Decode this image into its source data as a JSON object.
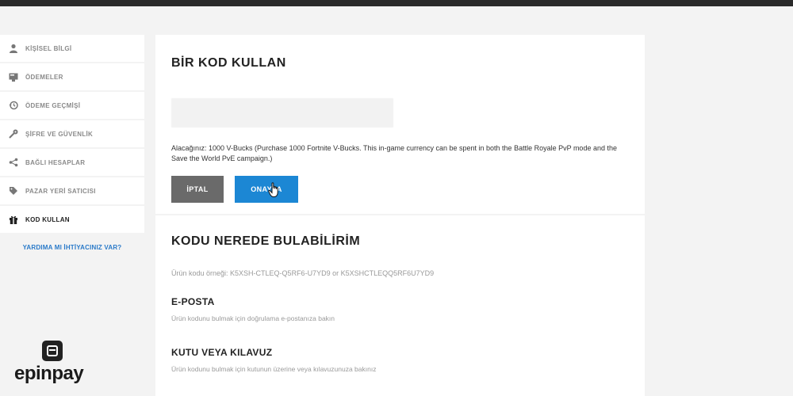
{
  "sidebar": {
    "items": [
      {
        "label": "KİŞİSEL BİLGİ",
        "icon": "person-icon"
      },
      {
        "label": "ÖDEMELER",
        "icon": "payment-icon"
      },
      {
        "label": "ÖDEME GEÇMİŞİ",
        "icon": "history-icon"
      },
      {
        "label": "ŞİFRE VE GÜVENLİK",
        "icon": "key-icon"
      },
      {
        "label": "BAĞLI HESAPLAR",
        "icon": "share-icon"
      },
      {
        "label": "PAZAR YERİ SATICISI",
        "icon": "tag-icon"
      },
      {
        "label": "KOD KULLAN",
        "icon": "gift-icon",
        "active": true
      }
    ],
    "help_link": "YARDIMA MI İHTİYACINIZ VAR?"
  },
  "redeem": {
    "title": "BİR KOD KULLAN",
    "code_value": "",
    "description": "Alacağınız: 1000 V-Bucks (Purchase 1000 Fortnite V-Bucks. This in-game currency can be spent in both the Battle Royale PvP mode and the Save the World PvE campaign.)",
    "cancel_label": "İPTAL",
    "confirm_label": "ONAYLA"
  },
  "find": {
    "title": "KODU NEREDE BULABİLİRİM",
    "example": "Ürün kodu örneği: K5XSH-CTLEQ-Q5RF6-U7YD9 or K5XSHCTLEQQ5RF6U7YD9",
    "sections": [
      {
        "title": "E-POSTA",
        "desc": "Ürün kodunu bulmak için doğrulama e-postanıza bakın"
      },
      {
        "title": "KUTU VEYA KILAVUZ",
        "desc": "Ürün kodunu bulmak için kutunun üzerine veya kılavuzunuza bakınız"
      }
    ]
  },
  "brand": {
    "logo_text": "epinpay"
  },
  "colors": {
    "accent": "#1c87d4",
    "cancel": "#6a6a6a",
    "link": "#2a7ac9"
  }
}
